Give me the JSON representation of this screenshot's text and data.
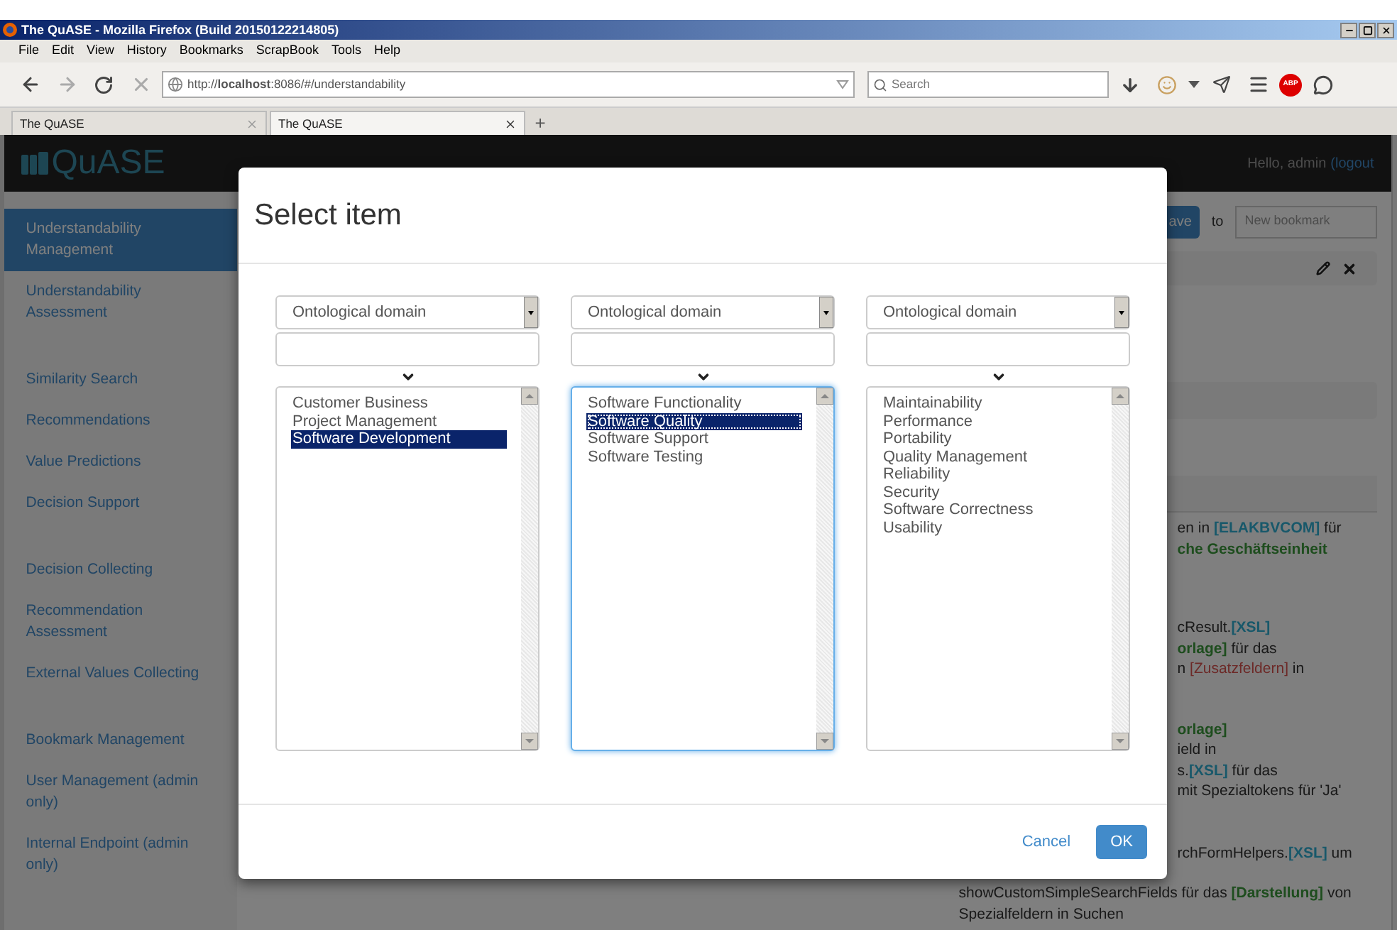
{
  "browser": {
    "title": "The QuASE - Mozilla Firefox (Build 20150122214805)",
    "menu": [
      "File",
      "Edit",
      "View",
      "History",
      "Bookmarks",
      "ScrapBook",
      "Tools",
      "Help"
    ],
    "url": "http://**localhost**:8086/#/understandability",
    "search_placeholder": "Search",
    "abp": "ABP",
    "tabs": [
      {
        "label": "The QuASE",
        "selected": false
      },
      {
        "label": "The QuASE",
        "selected": true
      }
    ],
    "new_tab": "+"
  },
  "app": {
    "logo": "QuASE",
    "greeting": "Hello, admin",
    "logout": "(logout",
    "sidebar": {
      "groups": [
        {
          "items": [
            {
              "label": "Understandability Management",
              "selected": true
            },
            {
              "label": "Understandability Assessment",
              "selected": false
            }
          ]
        },
        {
          "items": [
            {
              "label": "Similarity Search",
              "selected": false
            },
            {
              "label": "Recommendations",
              "selected": false
            },
            {
              "label": "Value Predictions",
              "selected": false
            },
            {
              "label": "Decision Support",
              "selected": false
            }
          ]
        },
        {
          "items": [
            {
              "label": "Decision Collecting",
              "selected": false
            },
            {
              "label": "Recommendation Assessment",
              "selected": false
            },
            {
              "label": "External Values Collecting",
              "selected": false
            }
          ]
        },
        {
          "items": [
            {
              "label": "Bookmark Management",
              "selected": false
            },
            {
              "label": "User Management (admin only)",
              "selected": false
            },
            {
              "label": "Internal Endpoint (admin only)",
              "selected": false
            }
          ]
        }
      ]
    },
    "toolbar": {
      "save": "ave",
      "to": "to",
      "bookmark_placeholder": "New bookmark"
    },
    "lines": [
      {
        "parts": [
          {
            "text": "en in ",
            "kind": "plain"
          },
          {
            "text": "[ELAKBVCOM]",
            "kind": "blue"
          },
          {
            "text": " für",
            "kind": "plain"
          }
        ]
      },
      {
        "parts": [
          {
            "text": "che Geschäftseinheit",
            "kind": "green"
          }
        ]
      },
      {
        "parts": [
          {
            "text": "cResult.",
            "kind": "plain"
          },
          {
            "text": "[XSL]",
            "kind": "blue"
          }
        ]
      },
      {
        "parts": [
          {
            "text": "orlage]",
            "kind": "green"
          },
          {
            "text": " für das",
            "kind": "plain"
          }
        ]
      },
      {
        "parts": [
          {
            "text": "n ",
            "kind": "plain"
          },
          {
            "text": "[Zusatzfeldern]",
            "kind": "red"
          },
          {
            "text": " in",
            "kind": "plain"
          }
        ]
      },
      {
        "parts": [
          {
            "text": "orlage]",
            "kind": "green"
          }
        ]
      },
      {
        "parts": [
          {
            "text": "ield in",
            "kind": "plain"
          }
        ]
      },
      {
        "parts": [
          {
            "text": "s.",
            "kind": "plain"
          },
          {
            "text": "[XSL]",
            "kind": "blue"
          },
          {
            "text": " für das",
            "kind": "plain"
          }
        ]
      },
      {
        "parts": [
          {
            "text": "mit Spezialtokens für 'Ja'",
            "kind": "plain"
          }
        ]
      },
      {
        "parts": [
          {
            "text": "rchFormHelpers.",
            "kind": "plain"
          },
          {
            "text": "[XSL]",
            "kind": "blue"
          },
          {
            "text": " um",
            "kind": "plain"
          }
        ]
      },
      {
        "parts": [
          {
            "text": "showCustomSimpleSearchFields für das ",
            "kind": "plain"
          },
          {
            "text": "[Darstellung]",
            "kind": "green"
          },
          {
            "text": " von",
            "kind": "plain"
          }
        ]
      },
      {
        "parts": [
          {
            "text": "Spezialfeldern in Suchen",
            "kind": "plain"
          }
        ]
      }
    ]
  },
  "dialog": {
    "title": "Select item",
    "columns": [
      {
        "select": "Ontological domain",
        "focused": false,
        "items": [
          {
            "label": "Customer Business",
            "selected": false
          },
          {
            "label": "Project Management",
            "selected": false
          },
          {
            "label": "Software Development",
            "selected": true
          }
        ]
      },
      {
        "select": "Ontological domain",
        "focused": true,
        "items": [
          {
            "label": "Software Functionality",
            "selected": false
          },
          {
            "label": "Software Quality",
            "selected": true
          },
          {
            "label": "Software Support",
            "selected": false
          },
          {
            "label": "Software Testing",
            "selected": false
          }
        ]
      },
      {
        "select": "Ontological domain",
        "focused": false,
        "items": [
          {
            "label": "Maintainability",
            "selected": false
          },
          {
            "label": "Performance",
            "selected": false
          },
          {
            "label": "Portability",
            "selected": false
          },
          {
            "label": "Quality Management",
            "selected": false
          },
          {
            "label": "Reliability",
            "selected": false
          },
          {
            "label": "Security",
            "selected": false
          },
          {
            "label": "Software Correctness",
            "selected": false
          },
          {
            "label": "Usability",
            "selected": false
          }
        ]
      }
    ],
    "cancel": "Cancel",
    "ok": "OK"
  }
}
